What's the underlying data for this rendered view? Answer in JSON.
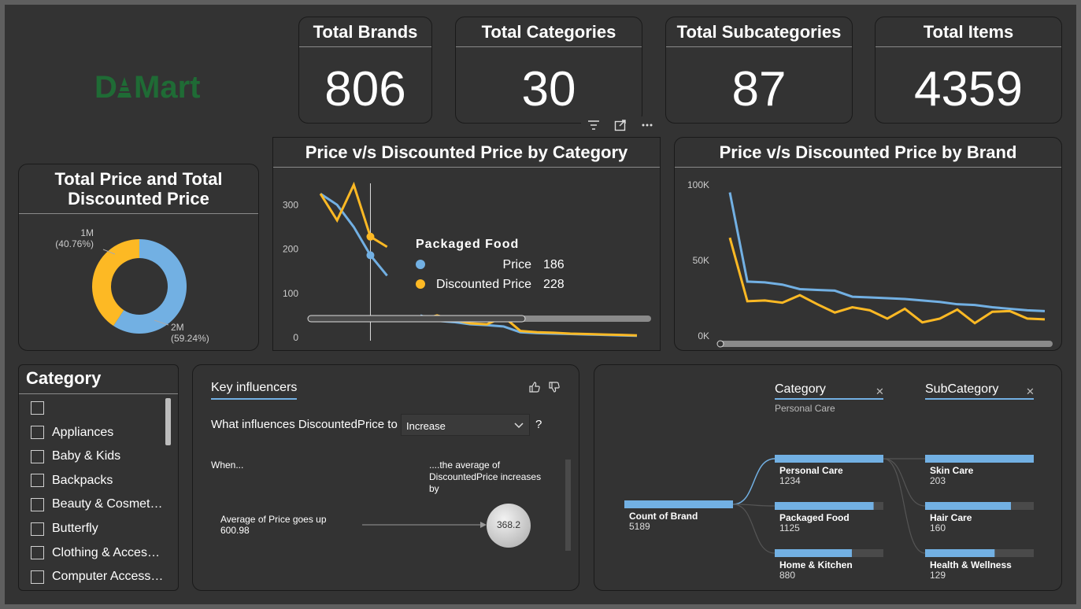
{
  "brand": {
    "logo_text": "DMart"
  },
  "kpis": [
    {
      "title": "Total Brands",
      "value": "806"
    },
    {
      "title": "Total Categories",
      "value": "30"
    },
    {
      "title": "Total Subcategories",
      "value": "87"
    },
    {
      "title": "Total Items",
      "value": "4359"
    }
  ],
  "donut": {
    "title_line1": "Total Price and Total",
    "title_line2": "Discounted Price",
    "label_small_value": "1M",
    "label_small_pct": "(40.76%)",
    "label_large_value": "2M",
    "label_large_pct": "(59.24%)",
    "colors": {
      "Total Price": "#72b0e3",
      "Total Discounted Price": "#fdb924"
    }
  },
  "chart_data": [
    {
      "type": "donut",
      "title": "Total Price and Total Discounted Price",
      "slices": [
        {
          "value": 59.24,
          "label": "2M",
          "color": "#72b0e3"
        },
        {
          "value": 40.76,
          "label": "1M",
          "color": "#fdb924"
        }
      ]
    },
    {
      "type": "line",
      "title": "Price v/s Discounted Price by Category",
      "ylim": [
        0,
        345
      ],
      "yticks": [
        "0",
        "100",
        "200",
        "300"
      ],
      "grid": false,
      "series": [
        {
          "name": "Price",
          "color": "#72b0e3",
          "values": [
            325,
            300,
            250,
            186,
            140,
            null,
            50,
            38,
            35,
            30,
            28,
            25,
            12,
            10,
            9,
            8,
            7,
            6,
            5,
            4
          ]
        },
        {
          "name": "Discounted Price",
          "color": "#fdb924",
          "values": [
            325,
            265,
            345,
            228,
            205,
            null,
            40,
            50,
            40,
            32,
            30,
            47,
            15,
            12,
            11,
            9,
            8,
            7,
            6,
            5
          ]
        }
      ],
      "tooltip": {
        "category": "Packaged Food",
        "rows": [
          {
            "name": "Price",
            "value": "186"
          },
          {
            "name": "Discounted Price",
            "value": "228"
          }
        ]
      }
    },
    {
      "type": "line",
      "title": "Price v/s Discounted Price by Brand",
      "ylim": [
        0,
        100000
      ],
      "yticks": [
        "0K",
        "50K",
        "100K"
      ],
      "grid": false,
      "series": [
        {
          "name": "Price",
          "color": "#72b0e3",
          "values": [
            95000,
            36000,
            35500,
            34000,
            31000,
            30500,
            30000,
            26000,
            25500,
            25000,
            24500,
            23500,
            22500,
            21000,
            20500,
            19000,
            18000,
            17000,
            16500
          ]
        },
        {
          "name": "Discounted Price",
          "color": "#fdb924",
          "values": [
            65000,
            23000,
            23500,
            22000,
            27000,
            21000,
            15500,
            19000,
            17000,
            11500,
            18000,
            9000,
            11500,
            17500,
            8500,
            16000,
            16500,
            11500,
            11000
          ]
        }
      ]
    }
  ],
  "category_slicer": {
    "title": "Category",
    "items": [
      "",
      "Appliances",
      "Baby & Kids",
      "Backpacks",
      "Beauty & Cosmet…",
      "Butterfly",
      "Clothing & Acces…",
      "Computer Access…"
    ]
  },
  "key_influencers": {
    "tab": "Key influencers",
    "question": "What influences DiscountedPrice to",
    "dropdown_value": "Increase",
    "help": "?",
    "when_label": "When...",
    "result_label_1": "....the average of",
    "result_label_2": "DiscountedPrice increases",
    "result_label_3": "by",
    "factor_label": "Average of Price goes up",
    "factor_value": "600.98",
    "bubble_value": "368.2"
  },
  "decomp_tree": {
    "root": {
      "label": "Count of Brand",
      "value": "5189"
    },
    "level1": {
      "header": "Category",
      "filter": "Personal Care"
    },
    "level2": {
      "header": "SubCategory"
    },
    "categories": [
      {
        "label": "Personal Care",
        "value": "1234",
        "fill": 1.0
      },
      {
        "label": "Packaged Food",
        "value": "1125",
        "fill": 0.91
      },
      {
        "label": "Home & Kitchen",
        "value": "880",
        "fill": 0.71
      }
    ],
    "subcategories": [
      {
        "label": "Skin Care",
        "value": "203",
        "fill": 1.0
      },
      {
        "label": "Hair Care",
        "value": "160",
        "fill": 0.79
      },
      {
        "label": "Health & Wellness",
        "value": "129",
        "fill": 0.64
      }
    ]
  },
  "visual_header": {
    "filter": "filter-icon",
    "focus": "focus-mode-icon",
    "more": "more-options-icon"
  }
}
